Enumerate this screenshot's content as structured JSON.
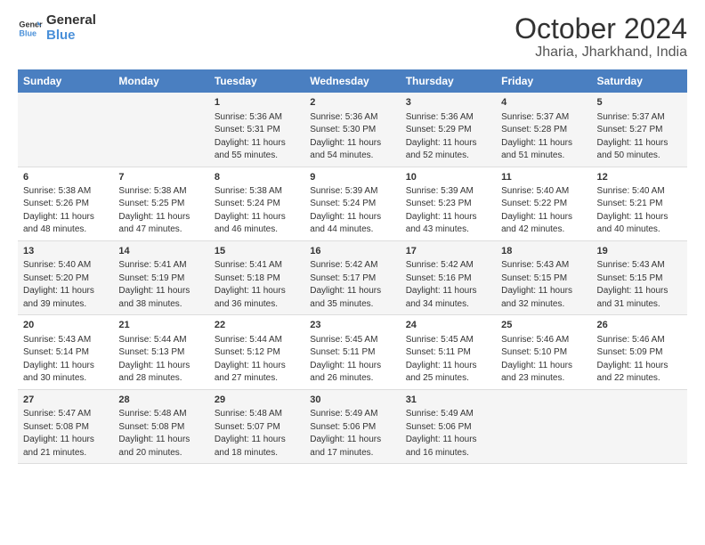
{
  "logo": {
    "line1": "General",
    "line2": "Blue"
  },
  "title": "October 2024",
  "subtitle": "Jharia, Jharkhand, India",
  "days_header": [
    "Sunday",
    "Monday",
    "Tuesday",
    "Wednesday",
    "Thursday",
    "Friday",
    "Saturday"
  ],
  "weeks": [
    [
      {
        "day": "",
        "info": ""
      },
      {
        "day": "",
        "info": ""
      },
      {
        "day": "1",
        "info": "Sunrise: 5:36 AM\nSunset: 5:31 PM\nDaylight: 11 hours and 55 minutes."
      },
      {
        "day": "2",
        "info": "Sunrise: 5:36 AM\nSunset: 5:30 PM\nDaylight: 11 hours and 54 minutes."
      },
      {
        "day": "3",
        "info": "Sunrise: 5:36 AM\nSunset: 5:29 PM\nDaylight: 11 hours and 52 minutes."
      },
      {
        "day": "4",
        "info": "Sunrise: 5:37 AM\nSunset: 5:28 PM\nDaylight: 11 hours and 51 minutes."
      },
      {
        "day": "5",
        "info": "Sunrise: 5:37 AM\nSunset: 5:27 PM\nDaylight: 11 hours and 50 minutes."
      }
    ],
    [
      {
        "day": "6",
        "info": "Sunrise: 5:38 AM\nSunset: 5:26 PM\nDaylight: 11 hours and 48 minutes."
      },
      {
        "day": "7",
        "info": "Sunrise: 5:38 AM\nSunset: 5:25 PM\nDaylight: 11 hours and 47 minutes."
      },
      {
        "day": "8",
        "info": "Sunrise: 5:38 AM\nSunset: 5:24 PM\nDaylight: 11 hours and 46 minutes."
      },
      {
        "day": "9",
        "info": "Sunrise: 5:39 AM\nSunset: 5:24 PM\nDaylight: 11 hours and 44 minutes."
      },
      {
        "day": "10",
        "info": "Sunrise: 5:39 AM\nSunset: 5:23 PM\nDaylight: 11 hours and 43 minutes."
      },
      {
        "day": "11",
        "info": "Sunrise: 5:40 AM\nSunset: 5:22 PM\nDaylight: 11 hours and 42 minutes."
      },
      {
        "day": "12",
        "info": "Sunrise: 5:40 AM\nSunset: 5:21 PM\nDaylight: 11 hours and 40 minutes."
      }
    ],
    [
      {
        "day": "13",
        "info": "Sunrise: 5:40 AM\nSunset: 5:20 PM\nDaylight: 11 hours and 39 minutes."
      },
      {
        "day": "14",
        "info": "Sunrise: 5:41 AM\nSunset: 5:19 PM\nDaylight: 11 hours and 38 minutes."
      },
      {
        "day": "15",
        "info": "Sunrise: 5:41 AM\nSunset: 5:18 PM\nDaylight: 11 hours and 36 minutes."
      },
      {
        "day": "16",
        "info": "Sunrise: 5:42 AM\nSunset: 5:17 PM\nDaylight: 11 hours and 35 minutes."
      },
      {
        "day": "17",
        "info": "Sunrise: 5:42 AM\nSunset: 5:16 PM\nDaylight: 11 hours and 34 minutes."
      },
      {
        "day": "18",
        "info": "Sunrise: 5:43 AM\nSunset: 5:15 PM\nDaylight: 11 hours and 32 minutes."
      },
      {
        "day": "19",
        "info": "Sunrise: 5:43 AM\nSunset: 5:15 PM\nDaylight: 11 hours and 31 minutes."
      }
    ],
    [
      {
        "day": "20",
        "info": "Sunrise: 5:43 AM\nSunset: 5:14 PM\nDaylight: 11 hours and 30 minutes."
      },
      {
        "day": "21",
        "info": "Sunrise: 5:44 AM\nSunset: 5:13 PM\nDaylight: 11 hours and 28 minutes."
      },
      {
        "day": "22",
        "info": "Sunrise: 5:44 AM\nSunset: 5:12 PM\nDaylight: 11 hours and 27 minutes."
      },
      {
        "day": "23",
        "info": "Sunrise: 5:45 AM\nSunset: 5:11 PM\nDaylight: 11 hours and 26 minutes."
      },
      {
        "day": "24",
        "info": "Sunrise: 5:45 AM\nSunset: 5:11 PM\nDaylight: 11 hours and 25 minutes."
      },
      {
        "day": "25",
        "info": "Sunrise: 5:46 AM\nSunset: 5:10 PM\nDaylight: 11 hours and 23 minutes."
      },
      {
        "day": "26",
        "info": "Sunrise: 5:46 AM\nSunset: 5:09 PM\nDaylight: 11 hours and 22 minutes."
      }
    ],
    [
      {
        "day": "27",
        "info": "Sunrise: 5:47 AM\nSunset: 5:08 PM\nDaylight: 11 hours and 21 minutes."
      },
      {
        "day": "28",
        "info": "Sunrise: 5:48 AM\nSunset: 5:08 PM\nDaylight: 11 hours and 20 minutes."
      },
      {
        "day": "29",
        "info": "Sunrise: 5:48 AM\nSunset: 5:07 PM\nDaylight: 11 hours and 18 minutes."
      },
      {
        "day": "30",
        "info": "Sunrise: 5:49 AM\nSunset: 5:06 PM\nDaylight: 11 hours and 17 minutes."
      },
      {
        "day": "31",
        "info": "Sunrise: 5:49 AM\nSunset: 5:06 PM\nDaylight: 11 hours and 16 minutes."
      },
      {
        "day": "",
        "info": ""
      },
      {
        "day": "",
        "info": ""
      }
    ]
  ]
}
